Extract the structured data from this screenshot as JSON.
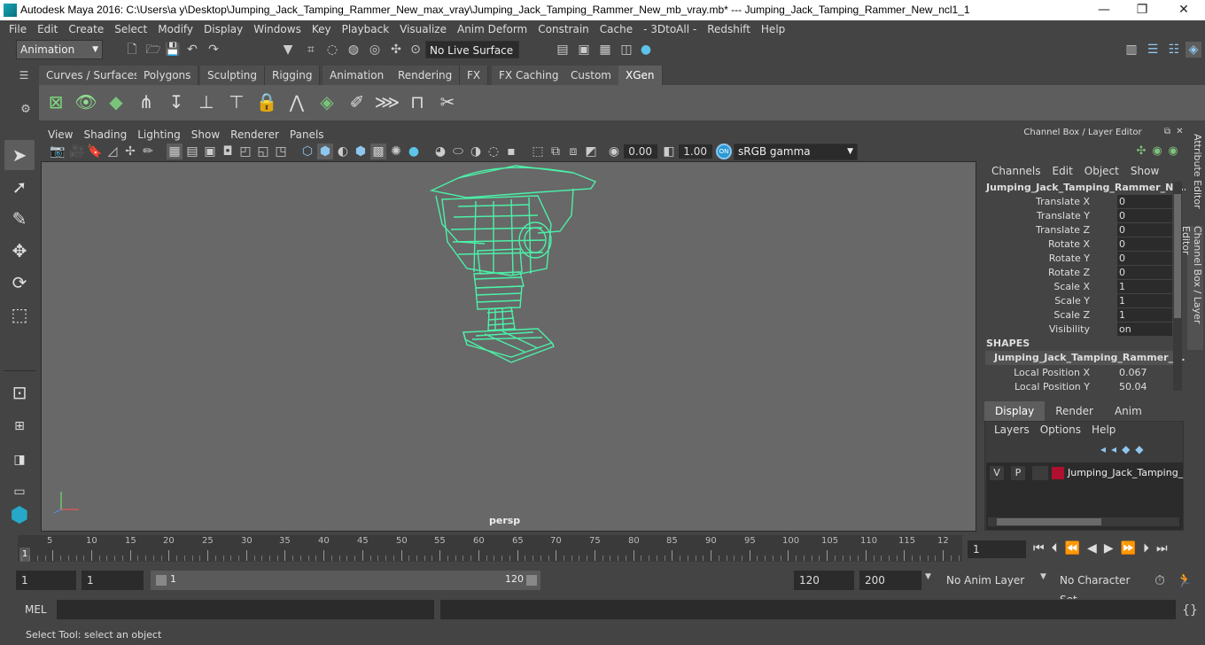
{
  "window": {
    "title": "Autodesk Maya 2016: C:\\Users\\a y\\Desktop\\Jumping_Jack_Tamping_Rammer_New_max_vray\\Jumping_Jack_Tamping_Rammer_New_mb_vray.mb*   ---   Jumping_Jack_Tamping_Rammer_New_ncl1_1",
    "minimize": "—",
    "maximize": "❐",
    "close": "✕"
  },
  "menu": [
    "File",
    "Edit",
    "Create",
    "Select",
    "Modify",
    "Display",
    "Windows",
    "Key",
    "Playback",
    "Visualize",
    "Anim Deform",
    "Constrain",
    "Cache",
    "- 3DtoAll -",
    "Redshift",
    "Help"
  ],
  "status": {
    "mode": "Animation",
    "live_surface": "No Live Surface"
  },
  "shelf": {
    "tabs": [
      "Curves / Surfaces",
      "Polygons",
      "Sculpting",
      "Rigging",
      "Animation",
      "Rendering",
      "FX",
      "FX Caching",
      "Custom",
      "XGen"
    ],
    "active_tab": "XGen"
  },
  "viewport": {
    "menu": [
      "View",
      "Shading",
      "Lighting",
      "Show",
      "Renderer",
      "Panels"
    ],
    "exposure": "0.00",
    "gamma": "1.00",
    "color_space": "sRGB gamma",
    "camera_label": "persp",
    "wire_color": "#4cf0a8"
  },
  "channel_box": {
    "title": "Channel Box / Layer Editor",
    "menu": [
      "Channels",
      "Edit",
      "Object",
      "Show"
    ],
    "object_name": "Jumping_Jack_Tamping_Rammer_Ne...",
    "channels": [
      {
        "name": "Translate X",
        "value": "0"
      },
      {
        "name": "Translate Y",
        "value": "0"
      },
      {
        "name": "Translate Z",
        "value": "0"
      },
      {
        "name": "Rotate X",
        "value": "0"
      },
      {
        "name": "Rotate Y",
        "value": "0"
      },
      {
        "name": "Rotate Z",
        "value": "0"
      },
      {
        "name": "Scale X",
        "value": "1"
      },
      {
        "name": "Scale Y",
        "value": "1"
      },
      {
        "name": "Scale Z",
        "value": "1"
      },
      {
        "name": "Visibility",
        "value": "on"
      }
    ],
    "shapes_header": "SHAPES",
    "shape_name": "Jumping_Jack_Tamping_Rammer_N...",
    "shape_channels": [
      {
        "name": "Local Position X",
        "value": "0.067"
      },
      {
        "name": "Local Position Y",
        "value": "50.04"
      }
    ]
  },
  "layer_editor": {
    "tabs": [
      "Display",
      "Render",
      "Anim"
    ],
    "active_tab": "Display",
    "menu": [
      "Layers",
      "Options",
      "Help"
    ],
    "layer": {
      "v": "V",
      "p": "P",
      "name": "Jumping_Jack_Tamping_",
      "color": "#b01030"
    }
  },
  "side_tabs": [
    "Attribute Editor",
    "Channel Box / Layer Editor"
  ],
  "timeline": {
    "ticks": [
      "5",
      "10",
      "15",
      "20",
      "25",
      "30",
      "35",
      "40",
      "45",
      "50",
      "55",
      "60",
      "65",
      "70",
      "75",
      "80",
      "85",
      "90",
      "95",
      "100",
      "105",
      "110",
      "115",
      "12"
    ],
    "start_marker": "1",
    "current_frame": "1"
  },
  "range": {
    "start": "1",
    "playback_start": "1",
    "slider_start": "1",
    "slider_end": "120",
    "playback_end": "120",
    "end": "200",
    "anim_layer": "No Anim Layer",
    "character_set": "No Character Set"
  },
  "mel": {
    "label": "MEL"
  },
  "help_line": "Select Tool: select an object"
}
